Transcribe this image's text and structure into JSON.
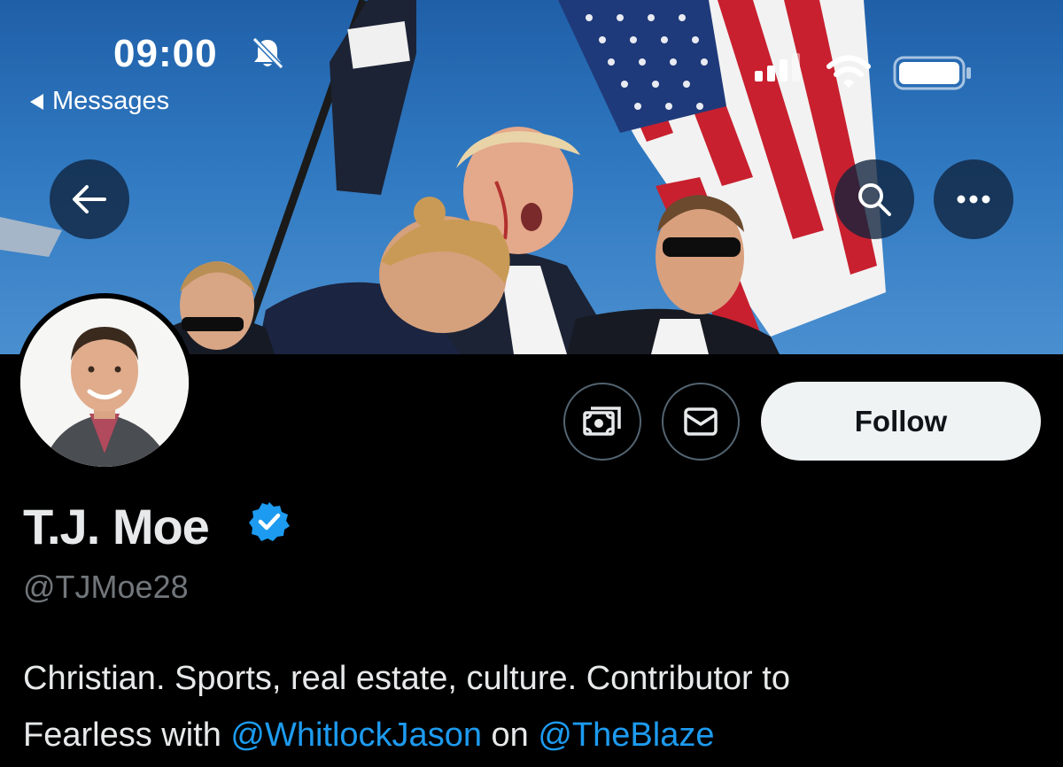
{
  "status_bar": {
    "time": "09:00",
    "back_app_label": "Messages",
    "silent_icon": "bell-slash-icon",
    "signal_icon": "cellular-signal-icon",
    "wifi_icon": "wifi-icon",
    "battery_icon": "battery-icon"
  },
  "banner": {
    "back_icon": "arrow-left-icon",
    "search_icon": "search-icon",
    "more_icon": "more-horizontal-icon"
  },
  "profile": {
    "display_name": "T.J. Moe",
    "handle": "@TJMoe28",
    "verified_color": "#1d9bf0",
    "verified_icon": "verified-badge-icon",
    "bio": {
      "line1": "Christian. Sports, real estate, culture. Contributor to",
      "line2_prefix": "Fearless with ",
      "mention1": "@WhitlockJason",
      "line2_middle": " on ",
      "mention2": "@TheBlaze"
    }
  },
  "actions": {
    "tip_icon": "tip-jar-money-icon",
    "message_icon": "envelope-icon",
    "follow_label": "Follow"
  },
  "colors": {
    "background": "#000000",
    "accent_link": "#1d9bf0",
    "secondary_text": "#71767b",
    "follow_button_bg": "#eff3f4"
  }
}
